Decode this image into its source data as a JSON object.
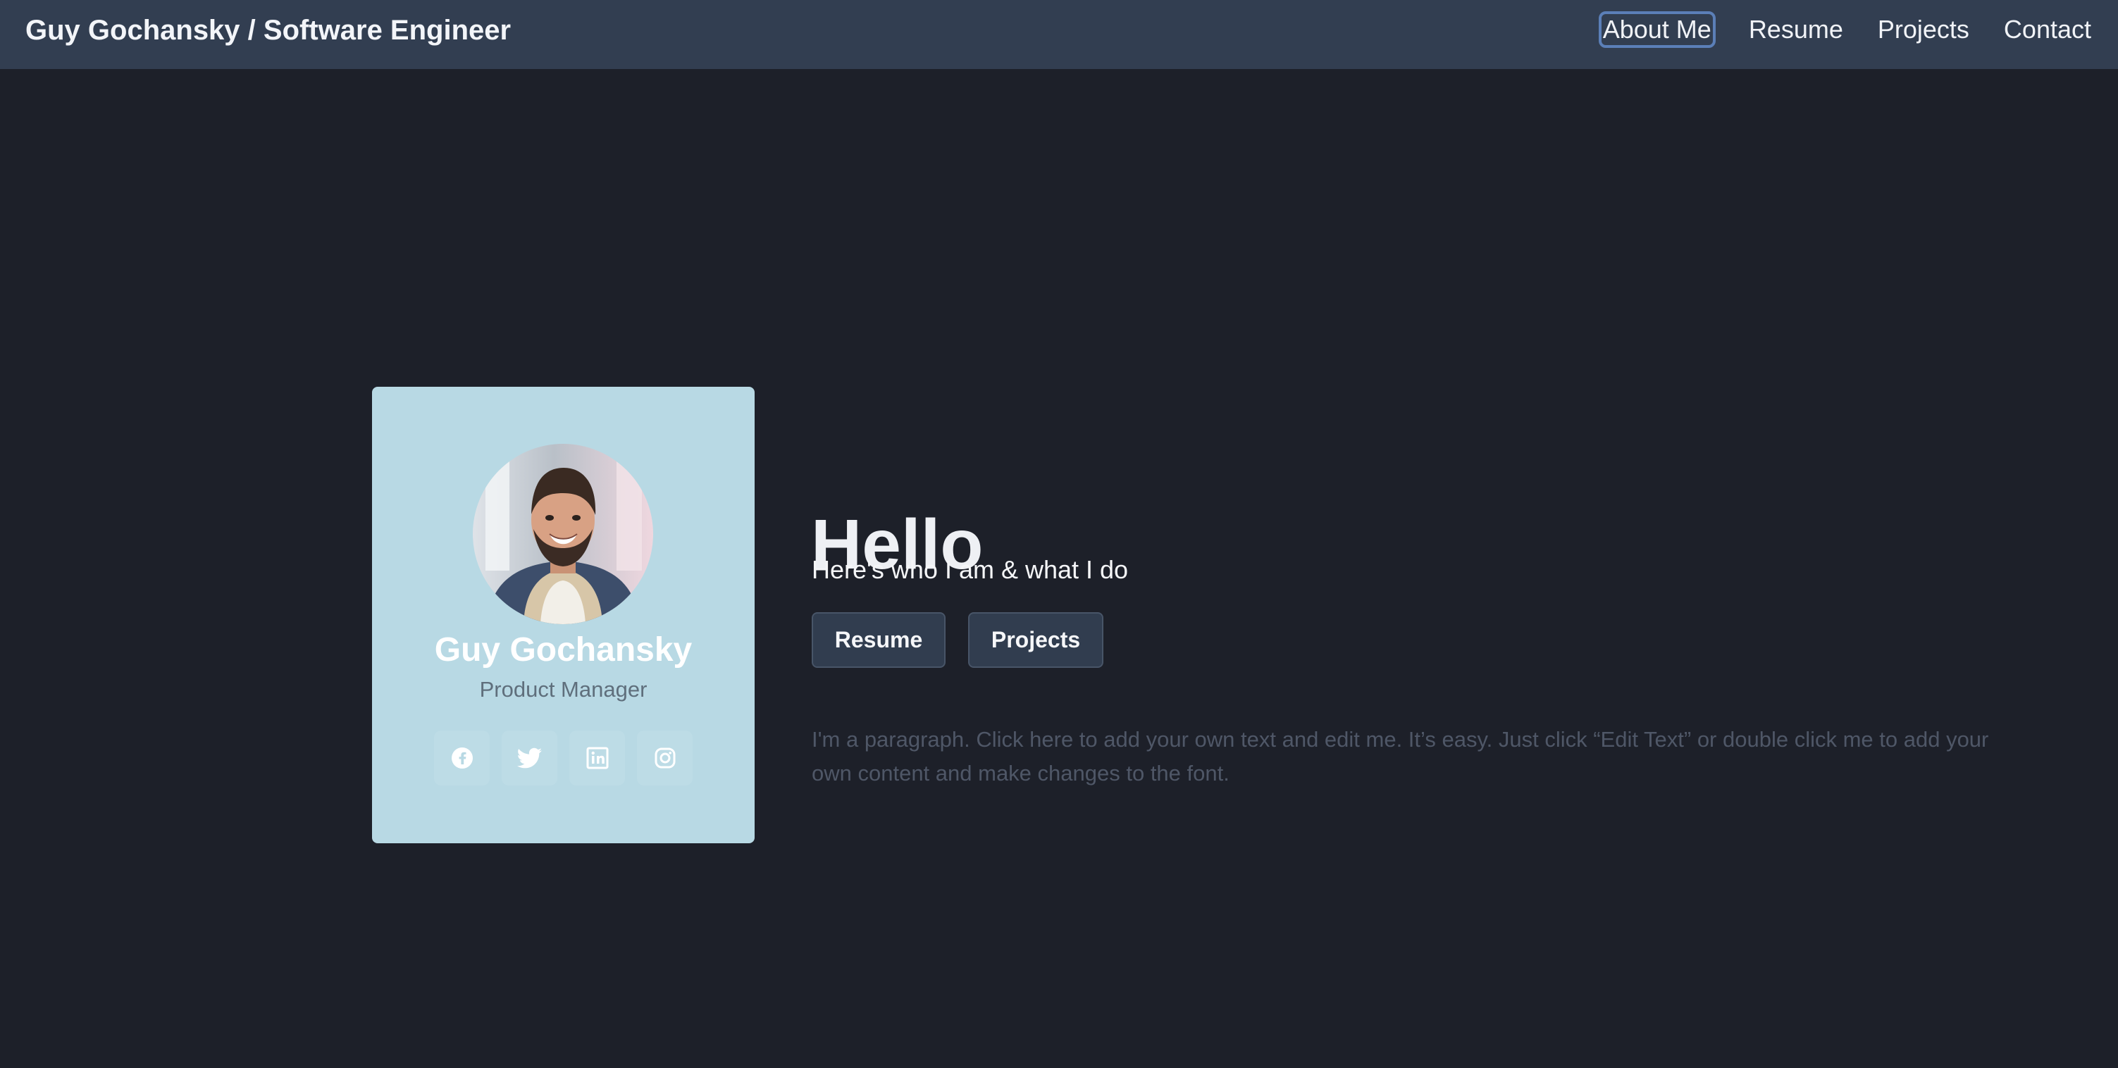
{
  "header": {
    "brand": "Guy Gochansky / Software Engineer",
    "nav": [
      {
        "label": "About Me",
        "active": true
      },
      {
        "label": "Resume",
        "active": false
      },
      {
        "label": "Projects",
        "active": false
      },
      {
        "label": "Contact",
        "active": false
      }
    ]
  },
  "profile": {
    "name": "Guy Gochansky",
    "role": "Product Manager",
    "socials": [
      {
        "icon": "facebook-icon"
      },
      {
        "icon": "twitter-icon"
      },
      {
        "icon": "linkedin-icon"
      },
      {
        "icon": "instagram-icon"
      }
    ]
  },
  "hero": {
    "title": "Hello",
    "subtitle": "Here's who I am & what I do",
    "buttons": {
      "resume": "Resume",
      "projects": "Projects"
    },
    "paragraph": "I'm a paragraph. Click here to add your own text and edit me. It’s easy. Just click “Edit Text” or double click me to add your own content and make changes to the font."
  },
  "colors": {
    "page_background": "#1d2029",
    "header_background": "#323e51",
    "card_background": "#b8d9e4",
    "button_background": "#313d4f",
    "active_outline": "#5b7fb8",
    "paragraph_text": "#4f5767"
  }
}
